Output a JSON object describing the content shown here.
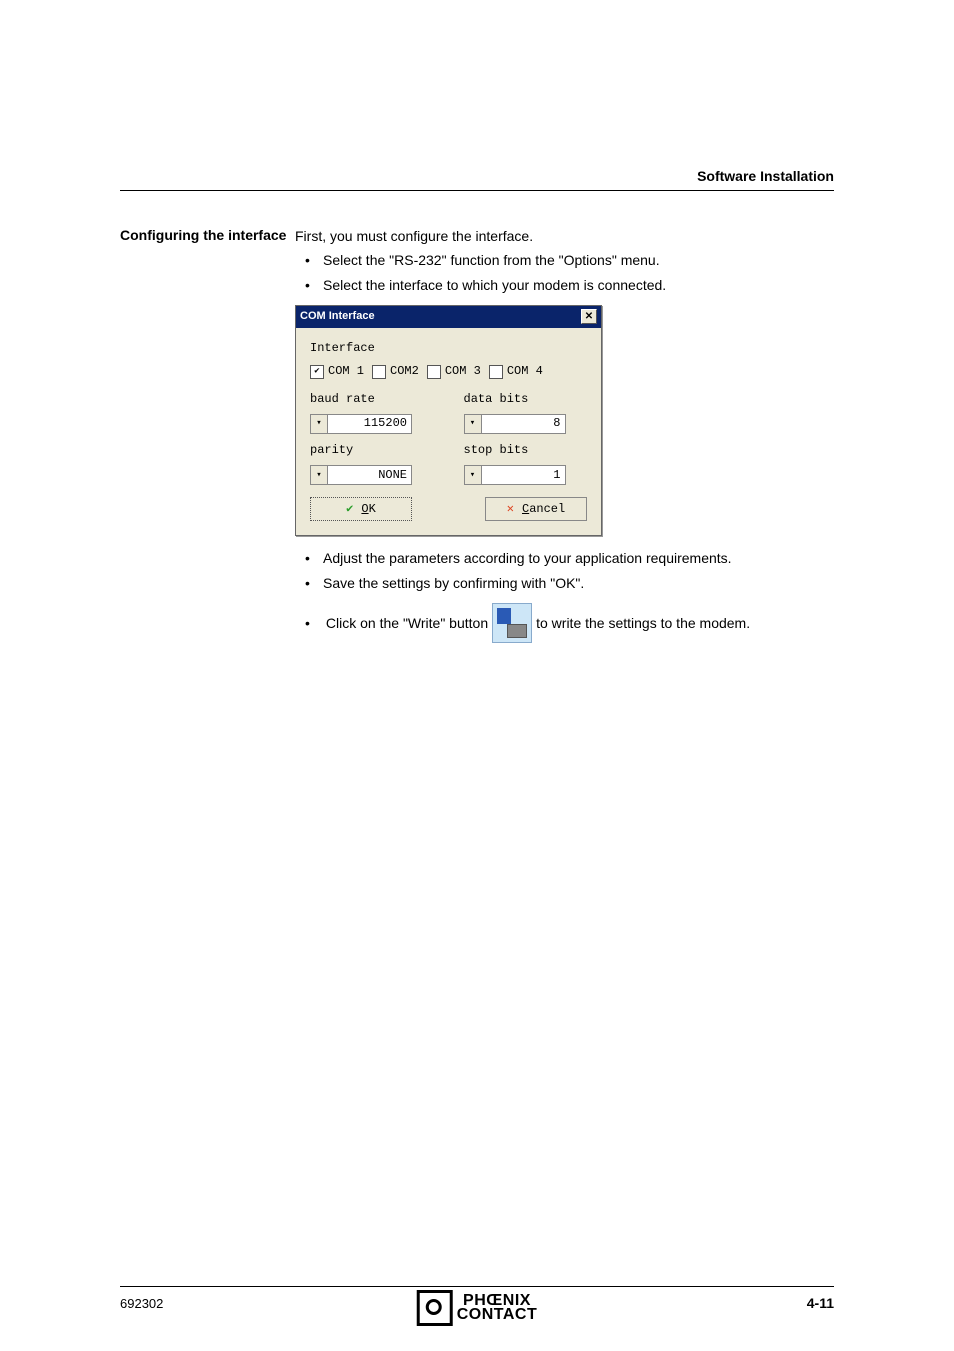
{
  "header": {
    "section_title": "Software Installation"
  },
  "sidebar": {
    "heading": "Configuring the interface"
  },
  "intro": "First, you must configure the interface.",
  "steps1": [
    "Select the \"RS-232\" function from the \"Options\" menu.",
    "Select the interface to which your modem is connected."
  ],
  "dialog": {
    "title": "COM Interface",
    "group_interface": "Interface",
    "ports": [
      {
        "label": "COM 1",
        "checked": true
      },
      {
        "label": "COM2",
        "checked": false
      },
      {
        "label": "COM 3",
        "checked": false
      },
      {
        "label": "COM 4",
        "checked": false
      }
    ],
    "baud_label": "baud rate",
    "baud_value": "115200",
    "data_bits_label": "data bits",
    "data_bits_value": "8",
    "parity_label": "parity",
    "parity_value": "NONE",
    "stop_bits_label": "stop bits",
    "stop_bits_value": "1",
    "ok": "OK",
    "cancel": "Cancel"
  },
  "steps2": [
    "Adjust the parameters according to your application requirements.",
    "Save the settings by confirming with \"OK\"."
  ],
  "write_line": {
    "before": "Click on the \"Write\" button ",
    "after": " to write the settings to the modem."
  },
  "footer": {
    "doc_id": "692302",
    "page": "4-11",
    "brand_top": "PHŒNIX",
    "brand_bottom": "CONTACT"
  }
}
